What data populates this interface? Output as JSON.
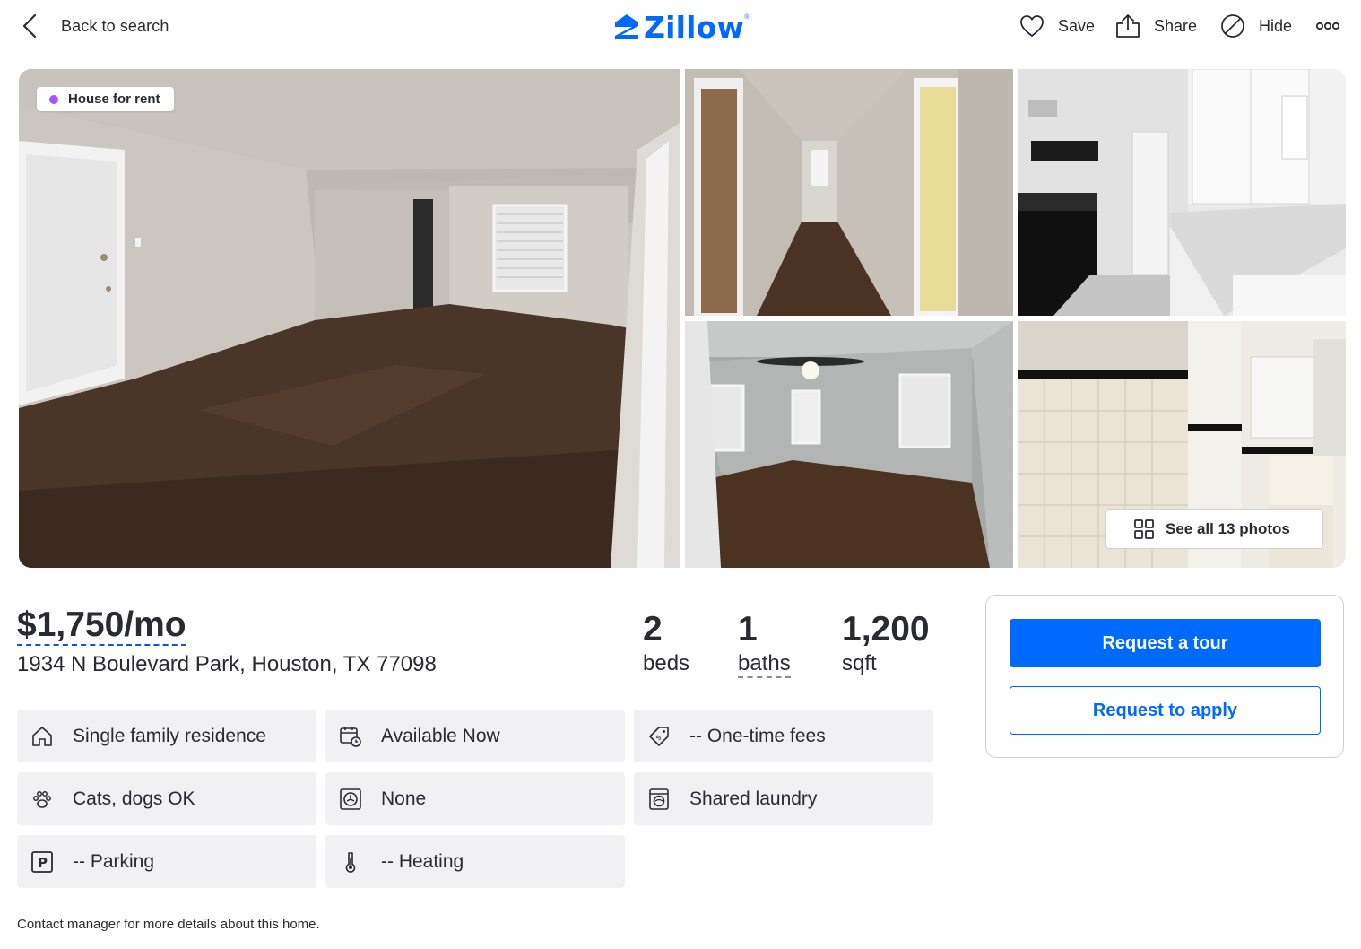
{
  "header": {
    "back_label": "Back to search",
    "logo_text": "Zillow",
    "logo_tm": "®",
    "actions": {
      "save": "Save",
      "share": "Share",
      "hide": "Hide"
    }
  },
  "gallery": {
    "badge": "House for rent",
    "badge_color": "#a855f7",
    "see_all": "See all 13 photos",
    "photos": [
      "living-room",
      "hallway",
      "kitchen",
      "bedroom",
      "bathroom"
    ]
  },
  "listing": {
    "price": "$1,750/mo",
    "address": "1934 N Boulevard Park, Houston, TX 77098",
    "beds_value": "2",
    "beds_label": "beds",
    "baths_value": "1",
    "baths_label": "baths",
    "sqft_value": "1,200",
    "sqft_label": "sqft"
  },
  "facts": {
    "home_type": "Single family residence",
    "availability": "Available Now",
    "fees": "-- One-time fees",
    "pets": "Cats, dogs OK",
    "cooling": "None",
    "laundry": "Shared laundry",
    "parking": "-- Parking",
    "heating": "-- Heating"
  },
  "footnote": "Contact manager for more details about this home.",
  "contact": {
    "tour_label": "Request a tour",
    "apply_label": "Request to apply"
  },
  "colors": {
    "brand": "#006aff",
    "text": "#2a2a33",
    "tile_bg": "#f1f1f4"
  }
}
